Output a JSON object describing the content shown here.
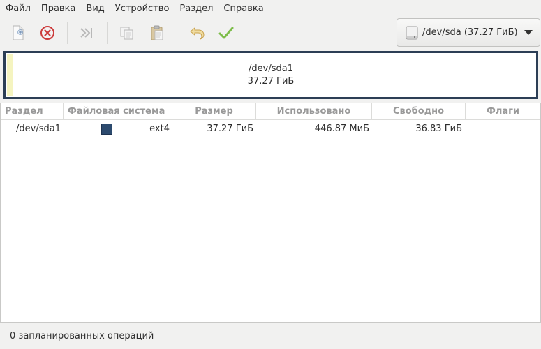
{
  "menu": {
    "items": [
      "Файл",
      "Правка",
      "Вид",
      "Устройство",
      "Раздел",
      "Справка"
    ]
  },
  "toolbar": {
    "buttons": [
      {
        "name": "new-partition",
        "icon": "new-document-icon"
      },
      {
        "name": "delete-partition",
        "icon": "delete-circle-icon"
      },
      {
        "name": "resize-move",
        "icon": "resize-arrow-icon"
      },
      {
        "name": "copy",
        "icon": "copy-icon"
      },
      {
        "name": "paste",
        "icon": "paste-icon"
      },
      {
        "name": "undo",
        "icon": "undo-icon"
      },
      {
        "name": "apply",
        "icon": "checkmark-icon"
      }
    ],
    "device_selector": "/dev/sda (37.27 ГиБ)"
  },
  "visual": {
    "partition_name": "/dev/sda1",
    "partition_size": "37.27 ГиБ"
  },
  "table": {
    "headers": [
      "Раздел",
      "Файловая система",
      "Размер",
      "Использовано",
      "Свободно",
      "Флаги"
    ],
    "rows": [
      {
        "partition": "/dev/sda1",
        "filesystem": "ext4",
        "fs_color": "#2c4a6e",
        "size": "37.27 ГиБ",
        "used": "446.87 МиБ",
        "free": "36.83 ГиБ",
        "flags": ""
      }
    ]
  },
  "status": {
    "text": "0 запланированных операций"
  },
  "colors": {
    "accent": "#2c3e55",
    "apply_green": "#6db33f",
    "undo_yellow": "#d8b25a",
    "delete_red": "#cc3b3b"
  }
}
